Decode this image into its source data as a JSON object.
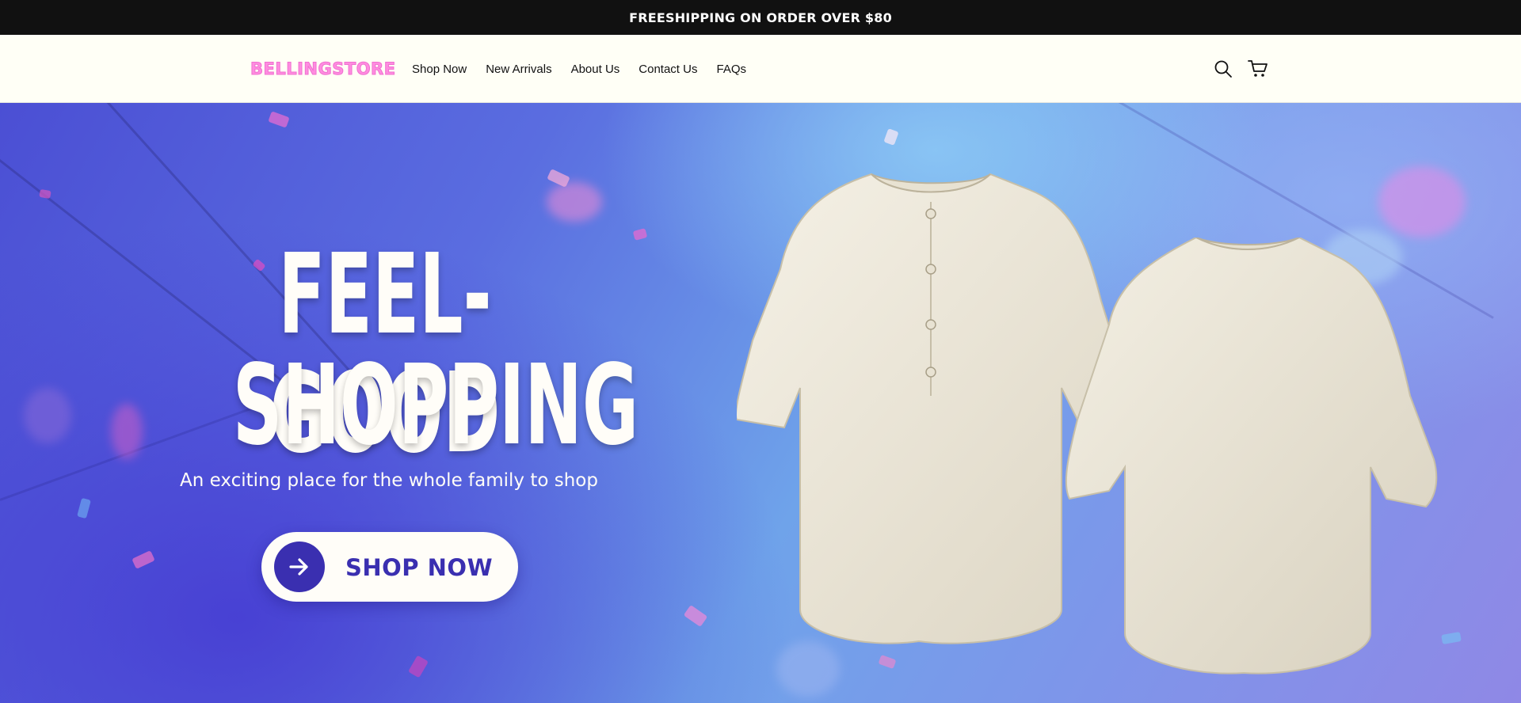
{
  "announcement": {
    "text": "FREESHIPPING ON ORDER OVER $80"
  },
  "header": {
    "logo": "BELLINGSTORE",
    "nav": [
      "Shop Now",
      "New Arrivals",
      "About Us",
      "Contact Us",
      "FAQs"
    ],
    "icons": [
      "search-icon",
      "cart-icon"
    ]
  },
  "hero": {
    "headline_line1": "FEEL-GOOD",
    "headline_line2": "SHOPPING",
    "subtitle": "An exciting place for the whole family to shop",
    "cta_label": "SHOP NOW",
    "cta_icon": "arrow-right-icon",
    "image": "two-linen-shirts",
    "colors": {
      "accent": "#3a2fb0",
      "logo": "#ff8ce0",
      "topbar": "#111111",
      "header_bg": "#fffff6"
    }
  }
}
